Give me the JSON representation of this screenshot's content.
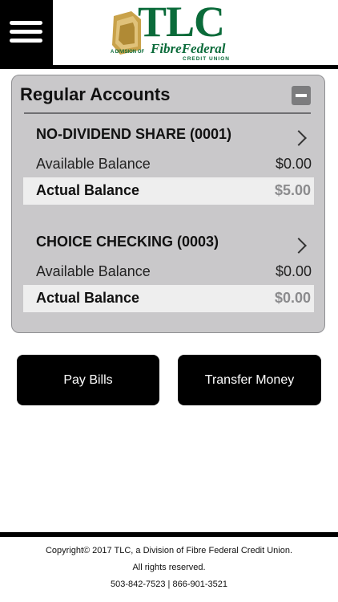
{
  "header": {
    "menu_icon": "hamburger-menu-icon",
    "logo": {
      "brand": "TLC",
      "division": "A DIVISION OF",
      "name": "FibreFederal",
      "subtitle": "CREDIT UNION"
    }
  },
  "section": {
    "title": "Regular Accounts",
    "collapse_icon": "minus-icon"
  },
  "accounts": [
    {
      "name": "NO-DIVIDEND SHARE (0001)",
      "available_label": "Available Balance",
      "available_value": "$0.00",
      "actual_label": "Actual Balance",
      "actual_value": "$5.00"
    },
    {
      "name": "CHOICE CHECKING (0003)",
      "available_label": "Available Balance",
      "available_value": "$0.00",
      "actual_label": "Actual Balance",
      "actual_value": "$0.00"
    }
  ],
  "actions": {
    "pay_bills": "Pay Bills",
    "transfer_money": "Transfer Money"
  },
  "footer": {
    "copyright": "Copyright© 2017 TLC, a Division of Fibre Federal Credit Union.",
    "rights": "All rights reserved.",
    "phones": "503-842-7523 | 866-901-3521"
  },
  "colors": {
    "brand_green": "#0b6b3a",
    "panel_bg": "#c9c8ca",
    "button_bg": "#000000"
  }
}
